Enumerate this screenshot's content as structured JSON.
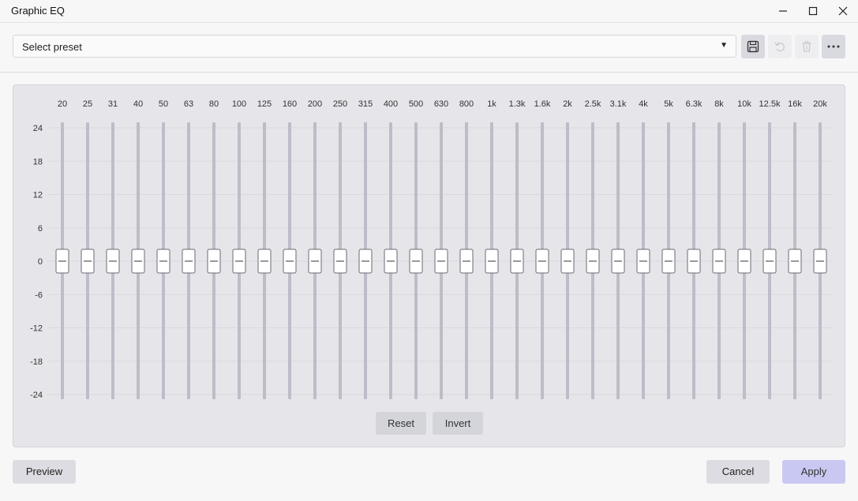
{
  "window": {
    "title": "Graphic EQ",
    "minimize_icon": "minimize-icon",
    "maximize_icon": "maximize-icon",
    "close_icon": "close-icon"
  },
  "toolbar": {
    "preset_placeholder": "Select preset",
    "preset_arrow": "▼",
    "save_icon": "save-icon",
    "undo_icon": "undo-icon",
    "delete_icon": "trash-icon",
    "more_icon": "more-horizontal-icon"
  },
  "eq": {
    "bands": [
      "20",
      "25",
      "31",
      "40",
      "50",
      "63",
      "80",
      "100",
      "125",
      "160",
      "200",
      "250",
      "315",
      "400",
      "500",
      "630",
      "800",
      "1k",
      "1.3k",
      "1.6k",
      "2k",
      "2.5k",
      "3.1k",
      "4k",
      "5k",
      "6.3k",
      "8k",
      "10k",
      "12.5k",
      "16k",
      "20k"
    ],
    "gains_db": [
      0,
      0,
      0,
      0,
      0,
      0,
      0,
      0,
      0,
      0,
      0,
      0,
      0,
      0,
      0,
      0,
      0,
      0,
      0,
      0,
      0,
      0,
      0,
      0,
      0,
      0,
      0,
      0,
      0,
      0,
      0
    ],
    "db_ticks": [
      "24",
      "18",
      "12",
      "6",
      "0",
      "-6",
      "-12",
      "-18",
      "-24"
    ],
    "range_db": [
      -24,
      24
    ],
    "reset_label": "Reset",
    "invert_label": "Invert"
  },
  "footer": {
    "preview_label": "Preview",
    "cancel_label": "Cancel",
    "apply_label": "Apply"
  },
  "colors": {
    "accent": "#c8c8f2",
    "panel_bg": "#e6e6ea",
    "track": "#bdbdc9"
  }
}
